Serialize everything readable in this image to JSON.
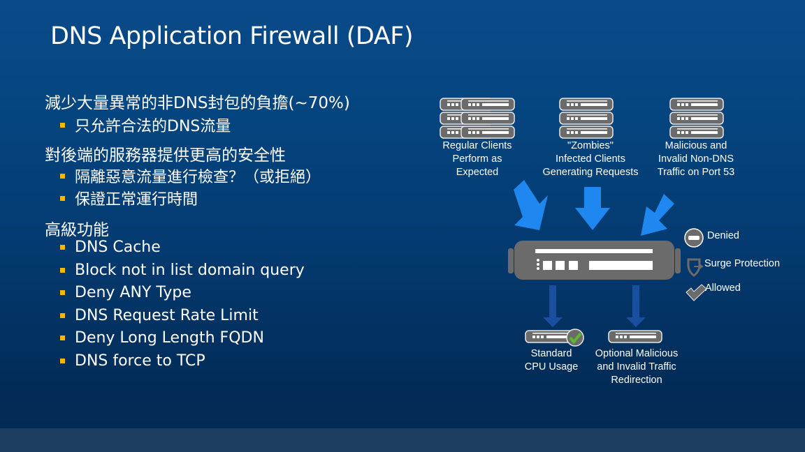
{
  "title": "DNS Application Firewall (DAF)",
  "bullets": {
    "section1": "減少大量異常的非DNS封包的負擔(~70%)",
    "section1_items": [
      "只允許合法的DNS流量"
    ],
    "section2": "對後端的服務器提供更高的安全性",
    "section2_items": [
      "隔離惡意流量進行檢查？（或拒絕）",
      "保證正常運行時間"
    ],
    "section3": "高級功能",
    "section3_items": [
      "DNS Cache",
      "Block not in list domain query",
      "Deny ANY Type",
      "DNS Request Rate Limit",
      "Deny Long Length FQDN",
      "DNS force to TCP"
    ]
  },
  "diagram": {
    "sources": [
      {
        "lines": [
          "Regular Clients",
          "Perform as",
          "Expected"
        ]
      },
      {
        "lines": [
          "\"Zombies\"",
          "Infected Clients",
          "Generating Requests"
        ]
      },
      {
        "lines": [
          "Malicious and",
          "Invalid Non-DNS",
          "Traffic on Port 53"
        ]
      }
    ],
    "outputs": [
      {
        "lines": [
          "Standard",
          "CPU Usage"
        ]
      },
      {
        "lines": [
          "Optional Malicious",
          "and Invalid Traffic",
          "Redirection"
        ]
      }
    ],
    "legend": {
      "denied": "Denied",
      "surge": "Surge Protection",
      "allowed": "Allowed"
    },
    "colors": {
      "arrow_in": "#1e88f0",
      "arrow_out": "#1a4fa0",
      "server_gray": "#6b6b6b",
      "check_green": "#5cb82e",
      "bullet": "#f5b800"
    }
  }
}
